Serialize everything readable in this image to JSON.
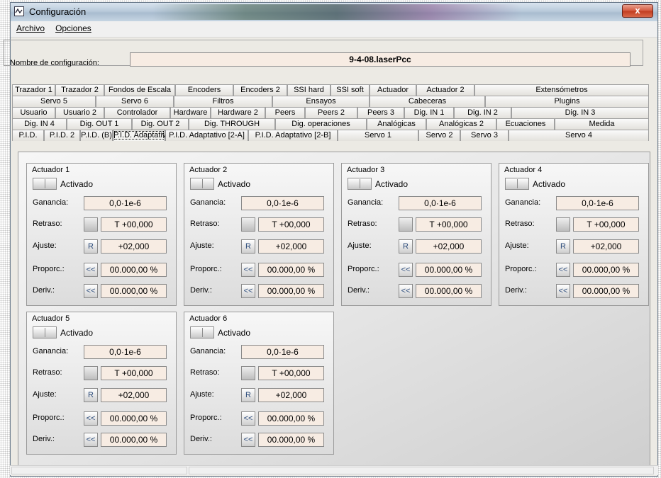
{
  "window": {
    "title": "Configuración",
    "close_label": "x"
  },
  "menu": [
    "Archivo",
    "Opciones"
  ],
  "config": {
    "label": "Nombre de configuración:",
    "value": "9-4-08.laserPcc"
  },
  "tab_rows": [
    [
      "Trazador 1",
      "Trazador 2",
      "Fondos de Escala",
      "Encoders",
      "Encoders 2",
      "SSI hard",
      "SSI soft",
      "Actuador",
      "Actuador 2",
      "Extensómetros"
    ],
    [
      "Servo 5",
      "Servo 6",
      "Filtros",
      "Ensayos",
      "Cabeceras",
      "Plugins"
    ],
    [
      "Usuario",
      "Usuario 2",
      "Controlador",
      "Hardware",
      "Hardware 2",
      "Peers",
      "Peers 2",
      "Peers 3",
      "Dig. IN 1",
      "Dig. IN 2",
      "Dig. IN 3"
    ],
    [
      "Dig. IN 4",
      "Dig. OUT 1",
      "Dig. OUT 2",
      "Dig. THROUGH",
      "Dig. operaciones",
      "Analógicas",
      "Analógicas 2",
      "Ecuaciones",
      "Medida"
    ],
    [
      "P.I.D.",
      "P.I.D. 2",
      "P.I.D. (B)",
      "P.I.D. Adaptativo",
      "P.I.D. Adaptativo [2-A]",
      "P.I.D. Adaptativo [2-B]",
      "Servo 1",
      "Servo 2",
      "Servo 3",
      "Servo 4"
    ]
  ],
  "active_tab": "P.I.D. Adaptativo",
  "labels": {
    "activado": "Activado",
    "ganancia": "Ganancia:",
    "retraso": "Retraso:",
    "ajuste": "Ajuste:",
    "proporc": "Proporc.:",
    "deriv": "Deriv.:",
    "ajuste_btn": "R",
    "arrow_btn": "<<"
  },
  "actuators": [
    {
      "title": "Actuador 1",
      "ganancia": "0,0·1e-6",
      "retraso": "T +00,000",
      "ajuste": "+02,000",
      "proporc": "00.000,00 %",
      "deriv": "00.000,00 %"
    },
    {
      "title": "Actuador 2",
      "ganancia": "0,0·1e-6",
      "retraso": "T +00,000",
      "ajuste": "+02,000",
      "proporc": "00.000,00 %",
      "deriv": "00.000,00 %"
    },
    {
      "title": "Actuador 3",
      "ganancia": "0,0·1e-6",
      "retraso": "T +00,000",
      "ajuste": "+02,000",
      "proporc": "00.000,00 %",
      "deriv": "00.000,00 %"
    },
    {
      "title": "Actuador 4",
      "ganancia": "0,0·1e-6",
      "retraso": "T +00,000",
      "ajuste": "+02,000",
      "proporc": "00.000,00 %",
      "deriv": "00.000,00 %"
    },
    {
      "title": "Actuador 5",
      "ganancia": "0,0·1e-6",
      "retraso": "T +00,000",
      "ajuste": "+02,000",
      "proporc": "00.000,00 %",
      "deriv": "00.000,00 %"
    },
    {
      "title": "Actuador 6",
      "ganancia": "0,0·1e-6",
      "retraso": "T +00,000",
      "ajuste": "+02,000",
      "proporc": "00.000,00 %",
      "deriv": "00.000,00 %"
    }
  ],
  "colors": {
    "field_bg": "#f7ece3",
    "close_red": "#c13b1f",
    "titlebar": "#b9cadb"
  }
}
